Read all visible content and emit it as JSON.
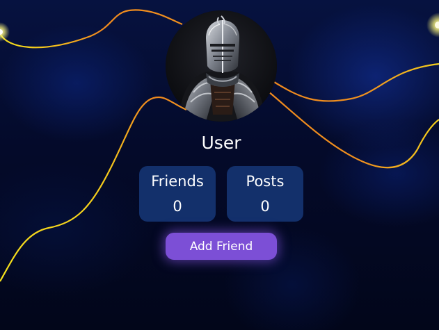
{
  "profile": {
    "username": "User",
    "avatar_icon": "armored-knight-avatar"
  },
  "stats": {
    "friends": {
      "label": "Friends",
      "value": "0"
    },
    "posts": {
      "label": "Posts",
      "value": "0"
    }
  },
  "actions": {
    "add_friend_label": "Add Friend"
  },
  "colors": {
    "card_bg": "#13306b",
    "button_bg": "#7c4fd6",
    "wire_yellow": "#f5e21c",
    "wire_orange": "#f08a1e",
    "text": "#ffffff"
  }
}
